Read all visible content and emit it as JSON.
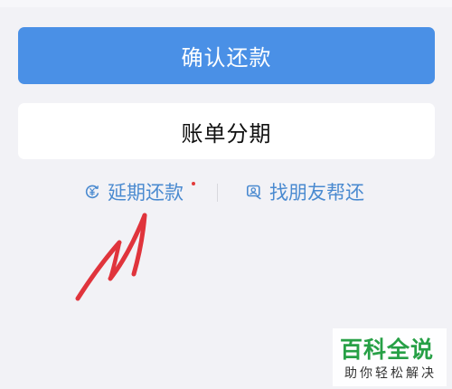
{
  "buttons": {
    "confirm_repay": "确认还款",
    "bill_installment": "账单分期"
  },
  "links": {
    "extend_repay": "延期还款",
    "friend_repay": "找朋友帮还"
  },
  "icons": {
    "extend_repay": "yuan-clock-icon",
    "friend_repay": "friend-card-icon",
    "badge": "red-dot-badge"
  },
  "watermark": {
    "title": "百科全说",
    "subtitle": "助你轻松解决"
  },
  "colors": {
    "primary": "#4a90e6",
    "link": "#4a8ad0",
    "badge": "#e23b3b",
    "annotation": "#e0343c",
    "watermark": "#27a046"
  }
}
